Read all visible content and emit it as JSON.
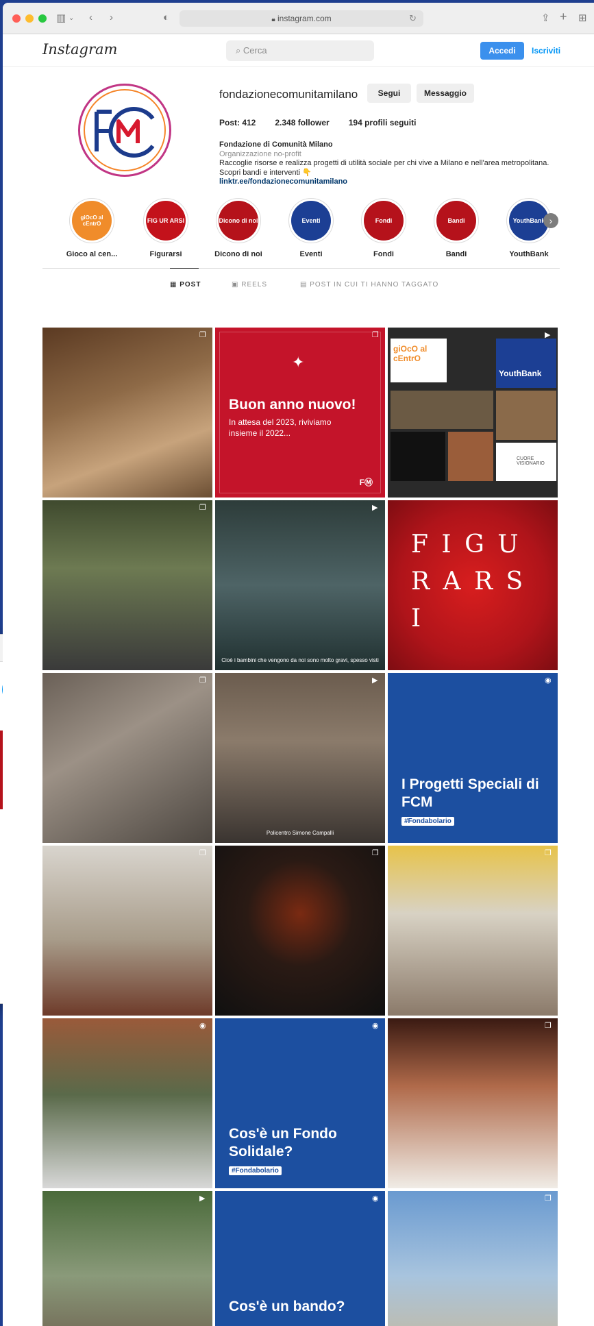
{
  "browser": {
    "url": "instagram.com",
    "colors": {
      "close": "#ff5f57",
      "minimize": "#febc2e",
      "zoom": "#28c840"
    }
  },
  "header": {
    "logo": "Instagram",
    "search_placeholder": "Cerca",
    "login_label": "Accedi",
    "signup_label": "Iscriviti",
    "accent": "#0095f6"
  },
  "profile": {
    "username": "fondazionecomunitamilano",
    "follow_label": "Segui",
    "message_label": "Messaggio",
    "stats": {
      "posts": "Post: 412",
      "followers": "2.348 follower",
      "following": "194 profili seguiti"
    },
    "bio": {
      "name": "Fondazione di Comunità Milano",
      "category": "Organizzazione no-profit",
      "text": "Raccoglie risorse e realizza progetti di utilità sociale per chi vive a Milano e nell'area metropolitana. Scopri bandi e interventi 👇",
      "link": "linktr.ee/fondazionecomunitamilano"
    }
  },
  "highlights": [
    {
      "label": "Gioco al cen...",
      "cover_text": "giOcO al cEntrO",
      "color": "#f08c2a"
    },
    {
      "label": "Figurarsi",
      "cover_text": "FIG UR ARSI",
      "color": "#c3121b"
    },
    {
      "label": "Dicono di noi",
      "cover_text": "Dicono di noi",
      "color": "#b5121b"
    },
    {
      "label": "Eventi",
      "cover_text": "Eventi",
      "color": "#1c3f94"
    },
    {
      "label": "Fondi",
      "cover_text": "Fondi",
      "color": "#b5121b"
    },
    {
      "label": "Bandi",
      "cover_text": "Bandi",
      "color": "#b5121b"
    },
    {
      "label": "YouthBank",
      "cover_text": "YouthBank",
      "color": "#1c3f94"
    }
  ],
  "tabs": [
    {
      "label": "POST",
      "icon": "grid-icon"
    },
    {
      "label": "REELS",
      "icon": "reels-icon"
    },
    {
      "label": "POST IN CUI TI HANNO TAGGATO",
      "icon": "tagged-icon"
    }
  ],
  "posts": {
    "new_year": {
      "title": "Buon anno nuovo!",
      "subtitle": "In attesa del 2023, riviviamo insieme il 2022..."
    },
    "collage": {
      "gioco": "giOcO al cEntrO",
      "youthbank": "YouthBank",
      "cuore": "CUORE VISIONARIO"
    },
    "figurarsi": "F I G U R A R S I",
    "hospital_caption": "Cioè i bambini che vengono da noi sono molto gravi, spesso visti",
    "speaker_caption": "Policentro Simone Campalli",
    "progetti": {
      "title": "I Progetti Speciali di FCM",
      "tag": "#Fondabolario"
    },
    "fondo": {
      "title": "Cos'è un Fondo Solidale?",
      "tag": "#Fondabolario"
    },
    "bando": {
      "title": "Cos'è un bando?"
    }
  },
  "back_window": {
    "button_fragment": "edi",
    "text_fragment": "nti"
  }
}
